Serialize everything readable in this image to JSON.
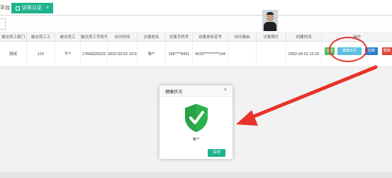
{
  "tabs": {
    "home_label": "平台",
    "active_label": "访客认证",
    "close_glyph": "×"
  },
  "table": {
    "headers": [
      "被访员工部门",
      "被访员工工",
      "被访员工",
      "被访员工手机号",
      "访问时间",
      "访客姓名",
      "访客手机号",
      "访客身份证号",
      "访问事由",
      "访客照片",
      "创建时间",
      "操作"
    ],
    "row": {
      "dept": "测试",
      "emp_no": "123",
      "emp_name": "千**",
      "emp_phone": "17609229222",
      "visit_time": "2022-03-02 10:20",
      "visitor_name": "朱**",
      "visitor_phone": "199****9431",
      "visitor_id": "4223**********134",
      "reason": "",
      "created": "2022-03-01 12:22"
    },
    "actions": {
      "auth": "认证",
      "health": "健康状况",
      "back": "后跑",
      "delete": "删除"
    }
  },
  "modal": {
    "title": "健康状况",
    "close_glyph": "×",
    "name": "朱**",
    "ok_label": "关闭"
  },
  "colors": {
    "brand": "#1fb38e",
    "shield": "#2bb24c",
    "annotation": "#e8322a"
  }
}
